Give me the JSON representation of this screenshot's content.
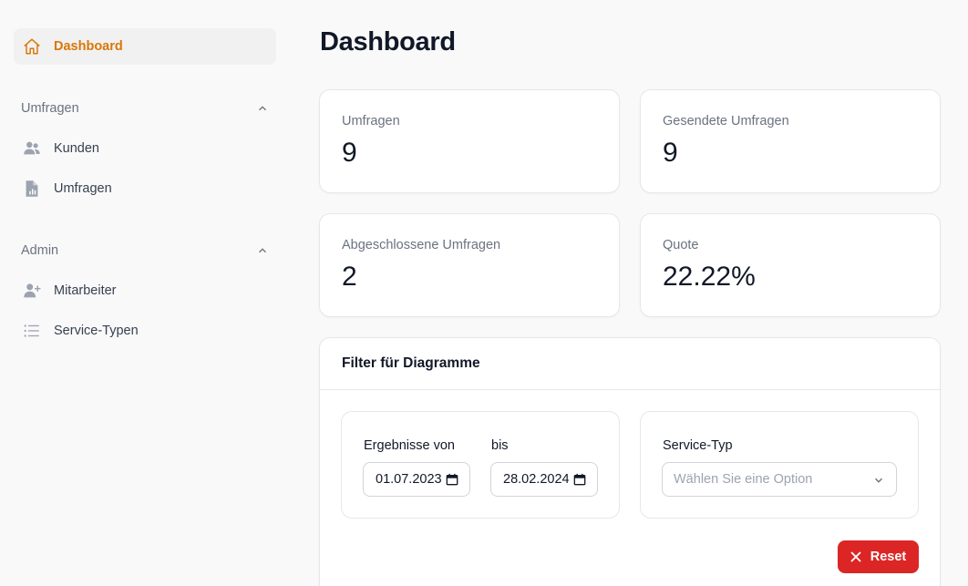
{
  "sidebar": {
    "dashboard_label": "Dashboard",
    "groups": [
      {
        "label": "Umfragen",
        "items": [
          {
            "label": "Kunden",
            "icon": "users-icon"
          },
          {
            "label": "Umfragen",
            "icon": "document-chart-icon"
          }
        ]
      },
      {
        "label": "Admin",
        "items": [
          {
            "label": "Mitarbeiter",
            "icon": "user-plus-icon"
          },
          {
            "label": "Service-Typen",
            "icon": "list-icon"
          }
        ]
      }
    ]
  },
  "main": {
    "title": "Dashboard",
    "stats": [
      {
        "label": "Umfragen",
        "value": "9"
      },
      {
        "label": "Gesendete Umfragen",
        "value": "9"
      },
      {
        "label": "Abgeschlossene Umfragen",
        "value": "2"
      },
      {
        "label": "Quote",
        "value": "22.22%"
      }
    ],
    "filter": {
      "title": "Filter für Diagramme",
      "from_label": "Ergebnisse von",
      "from_value": "01.07.2023",
      "to_label": "bis",
      "to_value": "28.02.2024",
      "service_label": "Service-Typ",
      "service_placeholder": "Wählen Sie eine Option",
      "reset_label": "Reset"
    }
  },
  "colors": {
    "accent": "#d97706",
    "danger": "#dc2626",
    "icon_gray": "#9ca3af"
  }
}
